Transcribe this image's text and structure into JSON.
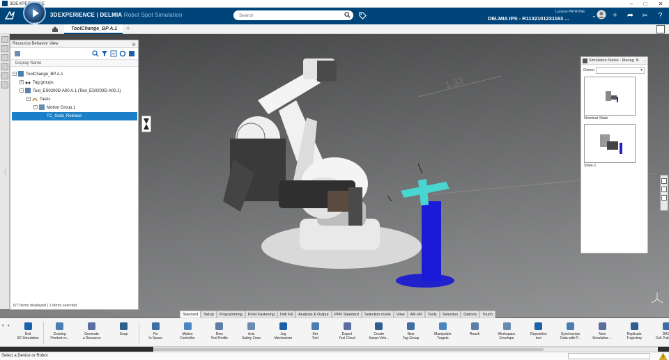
{
  "window": {
    "title": "3DEXPERIENCE"
  },
  "header": {
    "brand_prefix": "3DEXPERIENCE | DELMIA",
    "brand_app": "Robot Spot Simulation",
    "compass_version": "V.R",
    "search_placeholder": "Search",
    "user_name": "Luciano PATRONE",
    "collab_space": "DELMIA IPS - R1132101231163 ...",
    "colors": {
      "header_bg": "#00457a",
      "accent": "#1b80c9"
    }
  },
  "tabs": {
    "main": "ToolChange_BP A.1",
    "add": "+"
  },
  "resource_panel": {
    "title": "Resource Behavior View",
    "column_header": "Display Name",
    "tree": [
      {
        "label": "ToolChange_BP A.1",
        "level": 0
      },
      {
        "label": "Tag groups",
        "level": 1
      },
      {
        "label": "Test_ES0200D-A00 A.1 (Test_ES0200D-A00.1)",
        "level": 1
      },
      {
        "label": "Tasks",
        "level": 2
      },
      {
        "label": "Motion Group.1",
        "level": 3
      },
      {
        "label": "TC_Grab_Release",
        "level": 4,
        "selected": true
      }
    ],
    "status": "6/7 items displayed | 1 items selected"
  },
  "sim_panel": {
    "title": "Simulation States - Manage",
    "owner_label": "Owner",
    "states": [
      {
        "label": "Nominal State"
      },
      {
        "label": "State.1"
      }
    ]
  },
  "action_tabs": [
    {
      "label": "Standard",
      "active": true
    },
    {
      "label": "Setup"
    },
    {
      "label": "Programming"
    },
    {
      "label": "Point Fastening"
    },
    {
      "label": "Drill Fill"
    },
    {
      "label": "Analysis & Output"
    },
    {
      "label": "PPR Standard"
    },
    {
      "label": "Selection mode"
    },
    {
      "label": "View"
    },
    {
      "label": "AR-VR"
    },
    {
      "label": "Tools"
    },
    {
      "label": "Selection"
    },
    {
      "label": "Options"
    },
    {
      "label": "Touch"
    }
  ],
  "commands": [
    {
      "label": "Exit\n3D Simulation",
      "icon": "exit-icon"
    },
    {
      "label": "Existing\nProduct or...",
      "icon": "existing-product-icon"
    },
    {
      "label": "Generate\na Resource",
      "icon": "generate-resource-icon"
    },
    {
      "label": "Snap",
      "icon": "snap-icon"
    },
    {
      "label": "Fix\nIn Space",
      "icon": "fix-in-space-icon"
    },
    {
      "label": "Motion\nController",
      "icon": "motion-controller-icon"
    },
    {
      "label": "New\nTool Profile",
      "icon": "tool-profile-icon"
    },
    {
      "label": "Axis\nSafety Zone",
      "icon": "axis-safety-zone-icon"
    },
    {
      "label": "Jog\nMechanism",
      "icon": "jog-mechanism-icon"
    },
    {
      "label": "Set\nTool",
      "icon": "set-tool-icon"
    },
    {
      "label": "Export\nTool Cloud",
      "icon": "export-tool-cloud-icon"
    },
    {
      "label": "Create\nSwept Volu...",
      "icon": "swept-volume-icon"
    },
    {
      "label": "New\nTag Group",
      "icon": "tag-group-icon"
    },
    {
      "label": "Manipulate\nTargets",
      "icon": "manipulate-targets-icon"
    },
    {
      "label": "Reach",
      "icon": "reach-icon"
    },
    {
      "label": "Workspace\nEnvelope",
      "icon": "workspace-envelope-icon"
    },
    {
      "label": "Reposition\ntool",
      "icon": "reposition-tool-icon"
    },
    {
      "label": "Synchronize\nData with P...",
      "icon": "synchronize-icon"
    },
    {
      "label": "New\nSimulation ...",
      "icon": "new-simulation-icon"
    },
    {
      "label": "Replicate\nTrajectory",
      "icon": "replicate-trajectory-icon"
    },
    {
      "label": "DAO\nCell Publica...",
      "icon": "dao-cell-icon"
    }
  ],
  "status_bar": {
    "message": "Select a Device or Robot"
  }
}
